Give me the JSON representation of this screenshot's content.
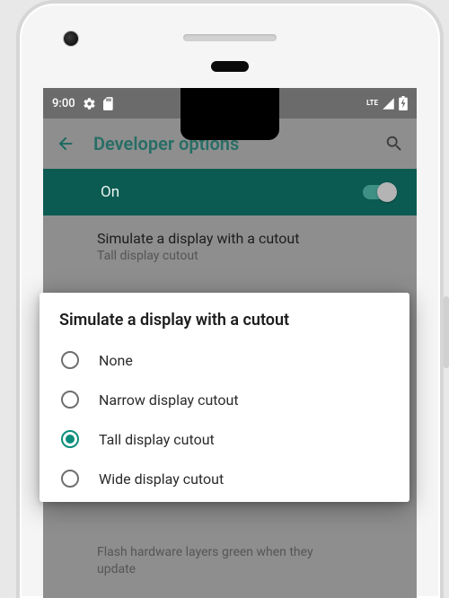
{
  "statusbar": {
    "time": "9:00",
    "network_label": "LTE"
  },
  "actionbar": {
    "title": "Developer options"
  },
  "main_toggle": {
    "label": "On",
    "state": true
  },
  "current_setting": {
    "title": "Simulate a display with a cutout",
    "value": "Tall display cutout"
  },
  "dialog": {
    "title": "Simulate a display with a cutout",
    "options": [
      {
        "label": "None",
        "selected": false
      },
      {
        "label": "Narrow display cutout",
        "selected": false
      },
      {
        "label": "Tall display cutout",
        "selected": true
      },
      {
        "label": "Wide display cutout",
        "selected": false
      }
    ]
  },
  "bg_setting_hint": "Flash hardware layers green when they update",
  "colors": {
    "accent": "#0b8e7b",
    "toggle_bg": "#0c5b52"
  }
}
